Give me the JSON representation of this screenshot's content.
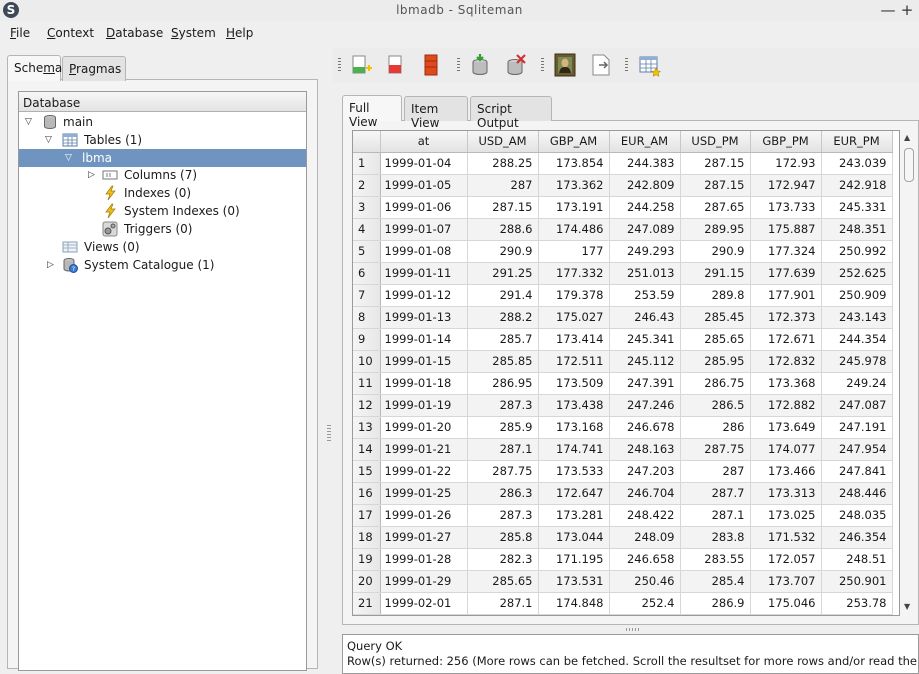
{
  "window": {
    "title": "lbmadb - Sqliteman",
    "logo_letter": "S",
    "min_glyph": "—",
    "max_glyph": "+"
  },
  "menu": [
    {
      "u": "F",
      "rest": "ile"
    },
    {
      "u": "C",
      "rest": "ontext"
    },
    {
      "u": "D",
      "rest": "atabase"
    },
    {
      "u": "S",
      "rest": "ystem"
    },
    {
      "u": "H",
      "rest": "elp"
    }
  ],
  "left_tabs": {
    "schema_pre": "Sche",
    "schema_u": "m",
    "schema_post": "a",
    "pragmas_u": "P",
    "pragmas_rest": "ragmas"
  },
  "tree": {
    "header": "Database",
    "items": [
      {
        "label": "main",
        "icon": "database-icon"
      },
      {
        "label": "Tables (1)",
        "icon": "table-icon"
      },
      {
        "label": "lbma",
        "icon": "table-item"
      },
      {
        "label": "Columns (7)",
        "icon": "columns-icon"
      },
      {
        "label": "Indexes (0)",
        "icon": "index-icon"
      },
      {
        "label": "System Indexes (0)",
        "icon": "index-icon"
      },
      {
        "label": "Triggers (0)",
        "icon": "trigger-icon"
      },
      {
        "label": "Views (0)",
        "icon": "views-icon"
      },
      {
        "label": "System Catalogue (1)",
        "icon": "system-catalogue-icon"
      }
    ]
  },
  "toolbar_icons": [
    "new-database-icon",
    "open-database-icon",
    "close-database-icon",
    "attach-database-icon",
    "detach-database-icon",
    "image-viewer-icon",
    "export-icon",
    "schema-browser-icon"
  ],
  "right_tabs": {
    "full_view": "Full View",
    "item_view": "Item View",
    "script_output": "Script Output"
  },
  "table": {
    "columns": [
      "at",
      "USD_AM",
      "GBP_AM",
      "EUR_AM",
      "USD_PM",
      "GBP_PM",
      "EUR_PM"
    ],
    "rows": [
      [
        "1",
        "1999-01-04",
        "288.25",
        "173.854",
        "244.383",
        "287.15",
        "172.93",
        "243.039"
      ],
      [
        "2",
        "1999-01-05",
        "287",
        "173.362",
        "242.809",
        "287.15",
        "172.947",
        "242.918"
      ],
      [
        "3",
        "1999-01-06",
        "287.15",
        "173.191",
        "244.258",
        "287.65",
        "173.733",
        "245.331"
      ],
      [
        "4",
        "1999-01-07",
        "288.6",
        "174.486",
        "247.089",
        "289.95",
        "175.887",
        "248.351"
      ],
      [
        "5",
        "1999-01-08",
        "290.9",
        "177",
        "249.293",
        "290.9",
        "177.324",
        "250.992"
      ],
      [
        "6",
        "1999-01-11",
        "291.25",
        "177.332",
        "251.013",
        "291.15",
        "177.639",
        "252.625"
      ],
      [
        "7",
        "1999-01-12",
        "291.4",
        "179.378",
        "253.59",
        "289.8",
        "177.901",
        "250.909"
      ],
      [
        "8",
        "1999-01-13",
        "288.2",
        "175.027",
        "246.43",
        "285.45",
        "172.373",
        "243.143"
      ],
      [
        "9",
        "1999-01-14",
        "285.7",
        "173.414",
        "245.341",
        "285.65",
        "172.671",
        "244.354"
      ],
      [
        "10",
        "1999-01-15",
        "285.85",
        "172.511",
        "245.112",
        "285.95",
        "172.832",
        "245.978"
      ],
      [
        "11",
        "1999-01-18",
        "286.95",
        "173.509",
        "247.391",
        "286.75",
        "173.368",
        "249.24"
      ],
      [
        "12",
        "1999-01-19",
        "287.3",
        "173.438",
        "247.246",
        "286.5",
        "172.882",
        "247.087"
      ],
      [
        "13",
        "1999-01-20",
        "285.9",
        "173.168",
        "246.678",
        "286",
        "173.649",
        "247.191"
      ],
      [
        "14",
        "1999-01-21",
        "287.1",
        "174.741",
        "248.163",
        "287.75",
        "174.077",
        "247.954"
      ],
      [
        "15",
        "1999-01-22",
        "287.75",
        "173.533",
        "247.203",
        "287",
        "173.466",
        "247.841"
      ],
      [
        "16",
        "1999-01-25",
        "286.3",
        "172.647",
        "246.704",
        "287.7",
        "173.313",
        "248.446"
      ],
      [
        "17",
        "1999-01-26",
        "287.3",
        "173.281",
        "248.422",
        "287.1",
        "173.025",
        "248.035"
      ],
      [
        "18",
        "1999-01-27",
        "285.8",
        "173.044",
        "248.09",
        "283.8",
        "171.532",
        "246.354"
      ],
      [
        "19",
        "1999-01-28",
        "282.3",
        "171.195",
        "246.658",
        "283.55",
        "172.057",
        "248.51"
      ],
      [
        "20",
        "1999-01-29",
        "285.65",
        "173.531",
        "250.46",
        "285.4",
        "173.707",
        "250.901"
      ],
      [
        "21",
        "1999-02-01",
        "287.1",
        "174.848",
        "252.4",
        "286.9",
        "175.046",
        "253.78"
      ]
    ]
  },
  "output": {
    "line1": "Query OK",
    "line2": "Row(s) returned: 256 (More rows can be fetched. Scroll the resultset for more rows and/or read the"
  }
}
